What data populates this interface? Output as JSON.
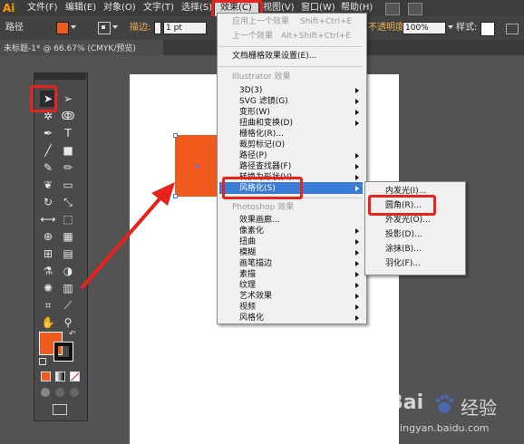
{
  "app_logo": "Ai",
  "menubar": {
    "items": [
      "文件(F)",
      "编辑(E)",
      "对象(O)",
      "文字(T)",
      "选择(S)",
      "效果(C)",
      "视图(V)",
      "窗口(W)",
      "帮助(H)"
    ]
  },
  "control_bar": {
    "label": "路径",
    "stroke_label": "描边:",
    "stroke_value": "1 pt",
    "opacity_label": "不透明度:",
    "opacity_value": "100%",
    "style_label": "样式:",
    "fill_color": "#f15a1d"
  },
  "document_tab": {
    "title": "未标题-1* @ 66.67% (CMYK/预览)"
  },
  "effect_menu": {
    "apply_last": "应用上一个效果",
    "apply_last_shortcut": "Shift+Ctrl+E",
    "last_effect": "上一个效果",
    "last_effect_shortcut": "Alt+Shift+Ctrl+E",
    "raster_settings": "文档栅格效果设置(E)...",
    "illustrator_header": "Illustrator 效果",
    "illustrator_items": [
      "3D(3)",
      "SVG 滤镜(G)",
      "变形(W)",
      "扭曲和变换(D)",
      "栅格化(R)...",
      "裁剪标记(O)",
      "路径(P)",
      "路径查找器(F)",
      "转换为形状(V)",
      "风格化(S)"
    ],
    "photoshop_header": "Photoshop 效果",
    "photoshop_items": [
      "效果画廊...",
      "像素化",
      "扭曲",
      "模糊",
      "画笔描边",
      "素描",
      "纹理",
      "艺术效果",
      "视频",
      "风格化"
    ]
  },
  "stylize_submenu": {
    "items": [
      "内发光(I)...",
      "圆角(R)...",
      "外发光(O)...",
      "投影(D)...",
      "涂抹(B)...",
      "羽化(F)..."
    ]
  },
  "watermark": {
    "brand": "Bai",
    "brand2": "经验",
    "url": "jingyan.baidu.com"
  },
  "colors": {
    "accent_red": "#e8221d",
    "highlight_blue": "#3a7bd5",
    "object_orange": "#f15a1d"
  }
}
